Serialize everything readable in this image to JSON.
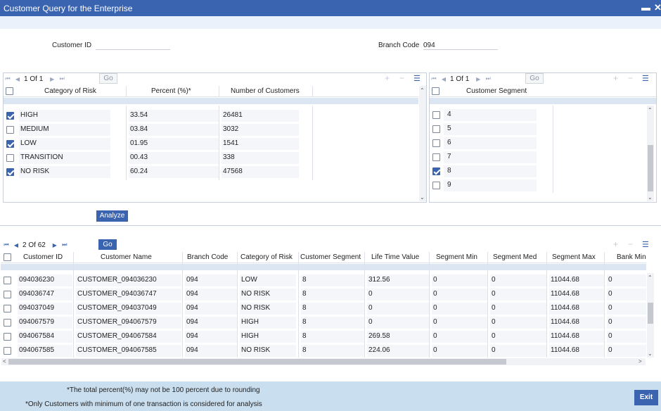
{
  "window": {
    "title": "Customer Query for the Enterprise",
    "minimize_icon": "▬",
    "close_icon": "✕"
  },
  "form": {
    "customer_id_label": "Customer ID",
    "customer_id_value": "",
    "branch_code_label": "Branch Code",
    "branch_code_value": "094"
  },
  "risk_table": {
    "pager": {
      "page": "1",
      "of_label": "Of",
      "total": "1",
      "go_label": "Go"
    },
    "columns": [
      "Category of Risk",
      "Percent (%)*",
      "Number of Customers"
    ],
    "rows": [
      {
        "checked": true,
        "category": "HIGH",
        "percent": "33.54",
        "count": "26481"
      },
      {
        "checked": false,
        "category": "MEDIUM",
        "percent": "03.84",
        "count": "3032"
      },
      {
        "checked": true,
        "category": "LOW",
        "percent": "01.95",
        "count": "1541"
      },
      {
        "checked": false,
        "category": "TRANSITION",
        "percent": "00.43",
        "count": "338"
      },
      {
        "checked": true,
        "category": "NO RISK",
        "percent": "60.24",
        "count": "47568"
      }
    ]
  },
  "segment_table": {
    "pager": {
      "page": "1",
      "of_label": "Of",
      "total": "1",
      "go_label": "Go"
    },
    "columns": [
      "Customer Segment"
    ],
    "rows": [
      {
        "checked": false,
        "segment": "4"
      },
      {
        "checked": false,
        "segment": "5"
      },
      {
        "checked": false,
        "segment": "6"
      },
      {
        "checked": false,
        "segment": "7"
      },
      {
        "checked": true,
        "segment": "8"
      },
      {
        "checked": false,
        "segment": "9"
      }
    ]
  },
  "analyze_label": "Analyze",
  "customer_table": {
    "pager": {
      "page": "2",
      "of_label": "Of",
      "total": "62",
      "go_label": "Go"
    },
    "columns": [
      "Customer ID",
      "Customer Name",
      "Branch Code",
      "Category of Risk",
      "Customer Segment",
      "Life Time Value",
      "Segment Min",
      "Segment Med",
      "Segment Max",
      "Bank Min"
    ],
    "rows": [
      {
        "id": "094036230",
        "name": "CUSTOMER_094036230",
        "branch": "094",
        "risk": "LOW",
        "segment": "8",
        "ltv": "312.56",
        "smin": "0",
        "smed": "0",
        "smax": "11044.68",
        "bmin": "0"
      },
      {
        "id": "094036747",
        "name": "CUSTOMER_094036747",
        "branch": "094",
        "risk": "NO RISK",
        "segment": "8",
        "ltv": "0",
        "smin": "0",
        "smed": "0",
        "smax": "11044.68",
        "bmin": "0"
      },
      {
        "id": "094037049",
        "name": "CUSTOMER_094037049",
        "branch": "094",
        "risk": "NO RISK",
        "segment": "8",
        "ltv": "0",
        "smin": "0",
        "smed": "0",
        "smax": "11044.68",
        "bmin": "0"
      },
      {
        "id": "094067579",
        "name": "CUSTOMER_094067579",
        "branch": "094",
        "risk": "HIGH",
        "segment": "8",
        "ltv": "0",
        "smin": "0",
        "smed": "0",
        "smax": "11044.68",
        "bmin": "0"
      },
      {
        "id": "094067584",
        "name": "CUSTOMER_094067584",
        "branch": "094",
        "risk": "HIGH",
        "segment": "8",
        "ltv": "269.58",
        "smin": "0",
        "smed": "0",
        "smax": "11044.68",
        "bmin": "0"
      },
      {
        "id": "094067585",
        "name": "CUSTOMER_094067585",
        "branch": "094",
        "risk": "NO RISK",
        "segment": "8",
        "ltv": "224.06",
        "smin": "0",
        "smed": "0",
        "smax": "11044.68",
        "bmin": "0"
      }
    ]
  },
  "footer": {
    "note1": "*The total percent(%) may not be 100 percent due to rounding",
    "note2": "*Only Customers with minimum of one transaction is considered for analysis",
    "exit_label": "Exit"
  },
  "icons": {
    "first": "first-page-icon",
    "prev": "prev-page-icon",
    "next": "next-page-icon",
    "last": "last-page-icon",
    "add": "add-row-icon",
    "remove": "delete-row-icon",
    "columns": "column-settings-icon"
  }
}
